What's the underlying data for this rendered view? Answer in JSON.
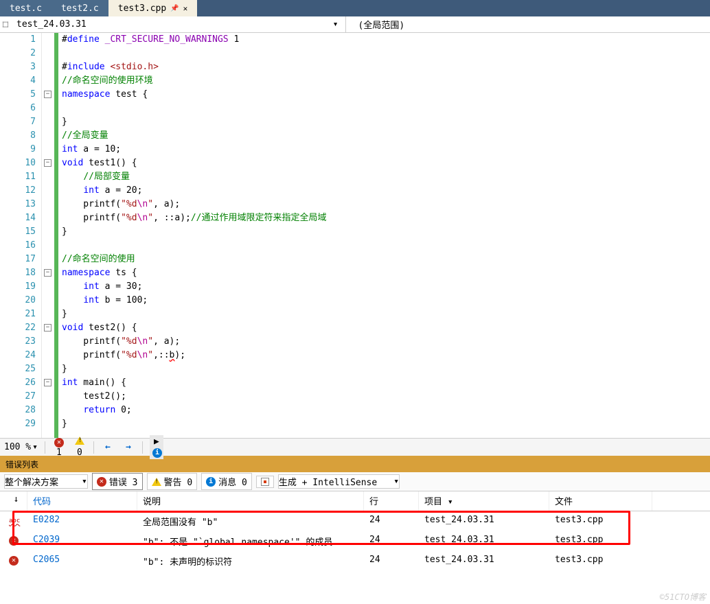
{
  "tabs": [
    {
      "label": "test.c",
      "active": false
    },
    {
      "label": "test2.c",
      "active": false
    },
    {
      "label": "test3.cpp",
      "active": true
    }
  ],
  "nav": {
    "left": "test_24.03.31",
    "right": "(全局范围)"
  },
  "code": {
    "lines": [
      {
        "n": 1,
        "html": "#<span class='kw'>define</span> <span class='mac'>_CRT_SECURE_NO_WARNINGS</span> 1"
      },
      {
        "n": 2,
        "html": ""
      },
      {
        "n": 3,
        "html": "#<span class='kw'>include</span> <span class='str'>&lt;stdio.h&gt;</span>"
      },
      {
        "n": 4,
        "html": "<span class='cmt'>//命名空间的使用环境</span>"
      },
      {
        "n": 5,
        "html": "<span class='kw'>namespace</span> test {",
        "fold": true
      },
      {
        "n": 6,
        "html": ""
      },
      {
        "n": 7,
        "html": "}"
      },
      {
        "n": 8,
        "html": "<span class='cmt'>//全局变量</span>"
      },
      {
        "n": 9,
        "html": "<span class='kw'>int</span> a = 10;"
      },
      {
        "n": 10,
        "html": "<span class='kw'>void</span> test1() {",
        "fold": true
      },
      {
        "n": 11,
        "html": "    <span class='cmt'>//局部变量</span>"
      },
      {
        "n": 12,
        "html": "    <span class='kw'>int</span> a = 20;"
      },
      {
        "n": 13,
        "html": "    printf(<span class='str'>\"%d<span class='esc'>\\n</span>\"</span>, a);"
      },
      {
        "n": 14,
        "html": "    printf(<span class='str'>\"%d<span class='esc'>\\n</span>\"</span>, ::a);<span class='cmt'>//通过作用域限定符来指定全局域</span>"
      },
      {
        "n": 15,
        "html": "}"
      },
      {
        "n": 16,
        "html": ""
      },
      {
        "n": 17,
        "html": "<span class='cmt'>//命名空间的使用</span>"
      },
      {
        "n": 18,
        "html": "<span class='kw'>namespace</span> ts {",
        "fold": true
      },
      {
        "n": 19,
        "html": "    <span class='kw'>int</span> a = 30;"
      },
      {
        "n": 20,
        "html": "    <span class='kw'>int</span> b = 100;"
      },
      {
        "n": 21,
        "html": "}"
      },
      {
        "n": 22,
        "html": "<span class='kw'>void</span> test2() {",
        "fold": true
      },
      {
        "n": 23,
        "html": "    printf(<span class='str'>\"%d<span class='esc'>\\n</span>\"</span>, a);"
      },
      {
        "n": 24,
        "html": "    printf(<span class='str'>\"%d<span class='esc'>\\n</span>\"</span>,::<span class='err'>b</span>);"
      },
      {
        "n": 25,
        "html": "}"
      },
      {
        "n": 26,
        "html": "<span class='kw'>int</span> main() {",
        "fold": true
      },
      {
        "n": 27,
        "html": "    test2();"
      },
      {
        "n": 28,
        "html": "    <span class='kw'>return</span> 0;"
      },
      {
        "n": 29,
        "html": "}"
      }
    ]
  },
  "status": {
    "zoom": "100 %",
    "errors": "1",
    "warnings": "0"
  },
  "errorlist": {
    "title": "错误列表",
    "scope": "整个解决方案",
    "filters": {
      "errors": "错误 3",
      "warnings": "警告 0",
      "messages": "消息 0"
    },
    "source": "生成 + IntelliSense",
    "cols": {
      "code": "代码",
      "desc": "说明",
      "line": "行",
      "proj": "项目",
      "file": "文件"
    },
    "rows": [
      {
        "icon": "abc",
        "code": "E0282",
        "desc": "全局范围没有 \"b\"",
        "line": "24",
        "proj": "test_24.03.31",
        "file": "test3.cpp"
      },
      {
        "icon": "err",
        "code": "C2039",
        "desc": "\"b\": 不是 \"`global namespace'\" 的成员",
        "line": "24",
        "proj": "test_24.03.31",
        "file": "test3.cpp"
      },
      {
        "icon": "err",
        "code": "C2065",
        "desc": "\"b\": 未声明的标识符",
        "line": "24",
        "proj": "test_24.03.31",
        "file": "test3.cpp"
      }
    ]
  },
  "watermark": "©51CTO博客"
}
